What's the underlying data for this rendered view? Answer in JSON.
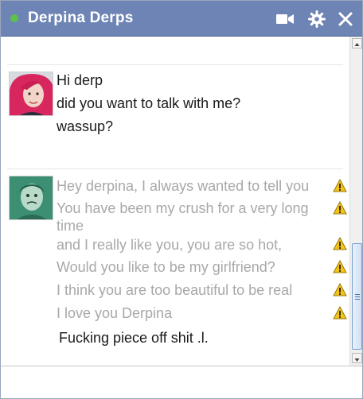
{
  "window": {
    "contact_name": "Derpina Derps",
    "presence_color": "#5dc04b",
    "header_color": "#6d84b4"
  },
  "toolbar": {
    "icons": [
      "video-call-icon",
      "gear-icon",
      "close-icon"
    ]
  },
  "conversation": {
    "incoming": {
      "avatar": "derpina-avatar",
      "messages": [
        "Hi derp",
        "did you want to talk with me?",
        "wassup?"
      ]
    },
    "outgoing": {
      "avatar": "derp-avatar",
      "failed_messages": [
        "Hey derpina, I always wanted to tell you",
        "You have been my crush for a very long time",
        "and I really like you, you are so hot,",
        "Would you like to be my girlfriend?",
        "I think you are too beautiful to be real",
        "I love you Derpina"
      ],
      "failed_status_icon": "warning-icon",
      "last_message": "Fucking piece off shit .l."
    }
  },
  "composer": {
    "value": "",
    "placeholder": ""
  }
}
